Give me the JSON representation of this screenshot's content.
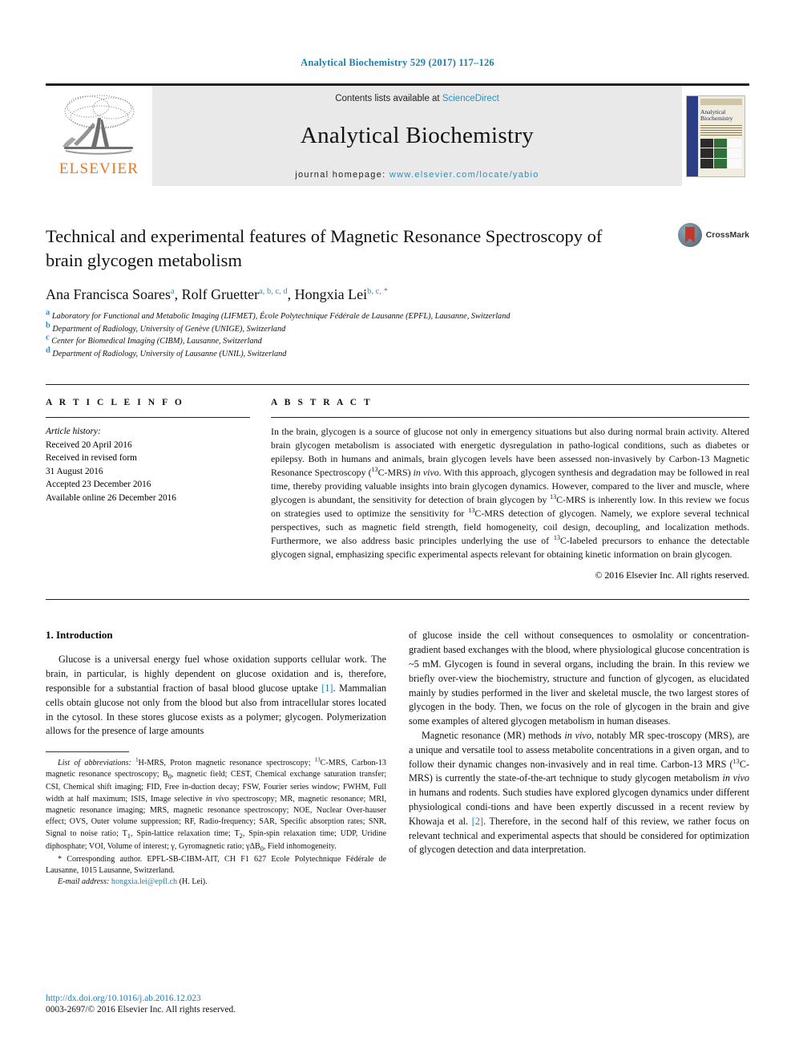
{
  "running_head": "Analytical Biochemistry 529 (2017) 117–126",
  "masthead": {
    "publisher_name": "ELSEVIER",
    "contents_prefix": "Contents lists available at ",
    "contents_link": "ScienceDirect",
    "journal_name": "Analytical Biochemistry",
    "homepage_prefix": "journal homepage: ",
    "homepage_url": "www.elsevier.com/locate/yabio",
    "cover_title_line1": "Analytical",
    "cover_title_line2": "Biochemistry"
  },
  "article": {
    "title": "Technical and experimental features of Magnetic Resonance Spectroscopy of brain glycogen metabolism",
    "crossmark_label": "CrossMark",
    "authors": [
      {
        "name": "Ana Francisca Soares",
        "marks": "a",
        "sep": ", "
      },
      {
        "name": "Rolf Gruetter",
        "marks": "a, b, c, d",
        "sep": ", "
      },
      {
        "name": "Hongxia Lei",
        "marks": "b, c, *",
        "sep": ""
      }
    ],
    "affiliations": [
      {
        "mark": "a",
        "text": "Laboratory for Functional and Metabolic Imaging (LIFMET), École Polytechnique Fédérale de Lausanne (EPFL), Lausanne, Switzerland"
      },
      {
        "mark": "b",
        "text": "Department of Radiology, University of Genève (UNIGE), Switzerland"
      },
      {
        "mark": "c",
        "text": "Center for Biomedical Imaging (CIBM), Lausanne, Switzerland"
      },
      {
        "mark": "d",
        "text": "Department of Radiology, University of Lausanne (UNIL), Switzerland"
      }
    ]
  },
  "article_info": {
    "heading": "A R T I C L E   I N F O",
    "history_label": "Article history:",
    "history": [
      "Received 20 April 2016",
      "Received in revised form",
      "31 August 2016",
      "Accepted 23 December 2016",
      "Available online 26 December 2016"
    ]
  },
  "abstract": {
    "heading": "A B S T R A C T",
    "paragraph_1": "In the brain, glycogen is a source of glucose not only in emergency situations but also during normal brain activity. Altered brain glycogen metabolism is associated with energetic dysregulation in patho-logical conditions, such as diabetes or epilepsy. Both in humans and animals, brain glycogen levels have been assessed non-invasively by Carbon-13 Magnetic Resonance Spectroscopy (",
    "isotope": "13",
    "paragraph_1b": "C-MRS) ",
    "invivo": "in vivo",
    "paragraph_1c": ". With this approach, glycogen synthesis and degradation may be followed in real time, thereby providing valuable insights into brain glycogen dynamics. However, compared to the liver and muscle, where glycogen is abundant, the sensitivity for detection of brain glycogen by ",
    "paragraph_1d": "C-MRS is inherently low. In this review we focus on strategies used to optimize the sensitivity for ",
    "paragraph_1e": "C-MRS detection of glycogen. Namely, we explore several technical perspectives, such as magnetic field strength, field homogeneity, coil design, decoupling, and localization methods. Furthermore, we also address basic principles underlying the use of ",
    "paragraph_1f": "C-labeled precursors to enhance the detectable glycogen signal, emphasizing specific experimental aspects relevant for obtaining kinetic information on brain glycogen.",
    "copyright": "© 2016 Elsevier Inc. All rights reserved."
  },
  "introduction": {
    "heading": "1. Introduction",
    "left_para_1a": "Glucose is a universal energy fuel whose oxidation supports cellular work. The brain, in particular, is highly dependent on glucose oxidation and is, therefore, responsible for a substantial fraction of basal blood glucose uptake ",
    "ref_1": "[1]",
    "left_para_1b": ". Mammalian cells obtain glucose not only from the blood but also from intracellular stores located in the cytosol. In these stores glucose exists as a polymer; glycogen. Polymerization allows for the presence of large amounts",
    "right_para_1": "of glucose inside the cell without consequences to osmolality or concentration-gradient based exchanges with the blood, where physiological glucose concentration is ~5 mM. Glycogen is found in several organs, including the brain. In this review we briefly over-view the biochemistry, structure and function of glycogen, as elucidated mainly by studies performed in the liver and skeletal muscle, the two largest stores of glycogen in the body. Then, we focus on the role of glycogen in the brain and give some examples of altered glycogen metabolism in human diseases.",
    "right_para_2a": "Magnetic resonance (MR) methods ",
    "right_invivo_1": "in vivo",
    "right_para_2b": ", notably MR spec-troscopy (MRS), are a unique and versatile tool to assess metabolite concentrations in a given organ, and to follow their dynamic changes non-invasively and in real time. Carbon-13 MRS (",
    "right_isotope": "13",
    "right_para_2c": "C-MRS) is currently the state-of-the-art technique to study glycogen metabolism ",
    "right_invivo_2": "in vivo",
    "right_para_2d": " in humans and rodents. Such studies have explored glycogen dynamics under different physiological condi-tions and have been expertly discussed in a recent review by Khowaja et al. ",
    "ref_2": "[2]",
    "right_para_2e": ". Therefore, in the second half of this review, we rather focus on relevant technical and experimental aspects that should be considered for optimization of glycogen detection and data interpretation."
  },
  "footnote": {
    "abbrev_label": "List of abbreviations:",
    "abbrev_sup_h": "1",
    "abbrev_text": "H-MRS, Proton magnetic resonance spectroscopy; ",
    "abbrev_sup_c": "13",
    "abbrev_text2": "C-MRS, Carbon-13 magnetic resonance spectroscopy; B",
    "abbrev_sub_0": "0",
    "abbrev_text3": ", magnetic field; CEST, Chemical exchange saturation transfer; CSI, Chemical shift imaging; FID, Free in-duction decay; FSW, Fourier series window; FWHM, Full width at half maximum; ISIS, Image selective ",
    "abbrev_invivo": "in vivo",
    "abbrev_text4": " spectroscopy; MR, magnetic resonance; MRI, magnetic resonance imaging; MRS, magnetic resonance spectroscopy; NOE, Nuclear Over-hauser effect; OVS, Outer volume suppression; RF, Radio-frequency; SAR, Specific absorption rates; SNR, Signal to noise ratio; T",
    "abbrev_sub_1": "1",
    "abbrev_text5": ", Spin-lattice relaxation time; T",
    "abbrev_sub_2": "2",
    "abbrev_text6": ", Spin-spin relaxation time; UDP, Uridine diphosphate; VOI, Volume of interest; γ, Gyromagnetic ratio; γΔB",
    "abbrev_sub_0b": "0",
    "abbrev_text7": ", Field inhomogeneity.",
    "corresponding_star": "*",
    "corresponding": " Corresponding author. EPFL-SB-CIBM-AIT, CH F1 627 Ecole Polytechnique Fédérale de Lausanne, 1015 Lausanne, Switzerland.",
    "email_label": "E-mail address:",
    "email": "hongxia.lei@epfl.ch",
    "email_suffix": " (H. Lei)."
  },
  "bottom": {
    "doi": "http://dx.doi.org/10.1016/j.ab.2016.12.023",
    "issn_prefix": "0003-2697/",
    "issn_copyright": "© 2016 Elsevier Inc. All rights reserved."
  },
  "colors": {
    "link_blue": "#1a7fb5",
    "sd_blue": "#2b8fc4",
    "elsevier_orange": "#e87722",
    "band_gray": "#e9e9e9"
  }
}
